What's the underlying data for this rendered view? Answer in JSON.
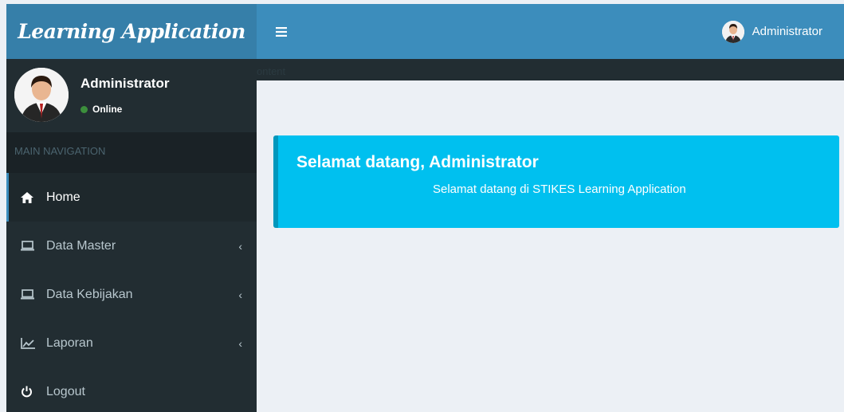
{
  "app": {
    "logo": "Learning Application"
  },
  "header": {
    "toggle_icon": "hamburger-icon",
    "user_name": "Administrator"
  },
  "sidebar": {
    "user": {
      "name": "Administrator",
      "status": "Online",
      "status_color": "#3c8f3c"
    },
    "nav_header": "MAIN NAVIGATION",
    "items": [
      {
        "label": "Home",
        "icon": "home-icon",
        "active": true
      },
      {
        "label": "Data Master",
        "icon": "laptop-icon",
        "has_submenu": true
      },
      {
        "label": "Data Kebijakan",
        "icon": "laptop-icon",
        "has_submenu": true
      },
      {
        "label": "Laporan",
        "icon": "line-chart-icon",
        "has_submenu": true
      },
      {
        "label": "Logout",
        "icon": "power-icon"
      }
    ],
    "submenu_arrow": "‹"
  },
  "content": {
    "ghost_text": "ontent",
    "callout": {
      "title": "Selamat datang, Administrator",
      "text": "Selamat datang di STIKES Learning Application"
    }
  },
  "colors": {
    "header": "#3c8dbc",
    "logo_bg": "#367fa9",
    "sidebar": "#222d32",
    "callout": "#00c0ef",
    "background": "#ecf0f5"
  }
}
